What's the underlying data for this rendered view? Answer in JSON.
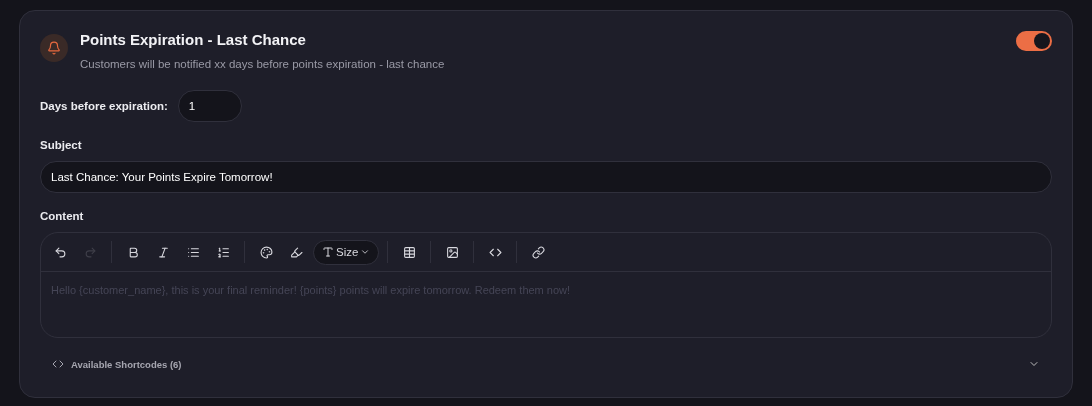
{
  "notification": {
    "title": "Points Expiration - Last Chance",
    "description": "Customers will be notified xx days before points expiration - last chance",
    "enabled": true
  },
  "days_field": {
    "label": "Days before expiration:",
    "value": "1"
  },
  "subject": {
    "label": "Subject",
    "value": "Last Chance: Your Points Expire Tomorrow!"
  },
  "content": {
    "label": "Content",
    "toolbar": [
      {
        "kind": "undo",
        "disabled": false
      },
      {
        "kind": "redo",
        "disabled": true
      },
      {
        "kind": "divider"
      },
      {
        "kind": "bold",
        "disabled": false
      },
      {
        "kind": "italic",
        "disabled": false
      },
      {
        "kind": "bullet-list",
        "disabled": false
      },
      {
        "kind": "numbered-list",
        "disabled": false
      },
      {
        "kind": "divider"
      },
      {
        "kind": "color",
        "disabled": false
      },
      {
        "kind": "highlight",
        "disabled": false
      },
      {
        "kind": "size",
        "label": "Size"
      },
      {
        "kind": "divider"
      },
      {
        "kind": "table",
        "disabled": false
      },
      {
        "kind": "divider"
      },
      {
        "kind": "image",
        "disabled": false
      },
      {
        "kind": "divider"
      },
      {
        "kind": "code",
        "disabled": false
      },
      {
        "kind": "divider"
      },
      {
        "kind": "link",
        "disabled": false
      }
    ],
    "placeholder": "Hello {customer_name}, this is your final reminder! {points} points will expire tomorrow. Redeem them now!"
  },
  "shortcodes": {
    "label": "Available Shortcodes (6)",
    "expanded": false
  }
}
